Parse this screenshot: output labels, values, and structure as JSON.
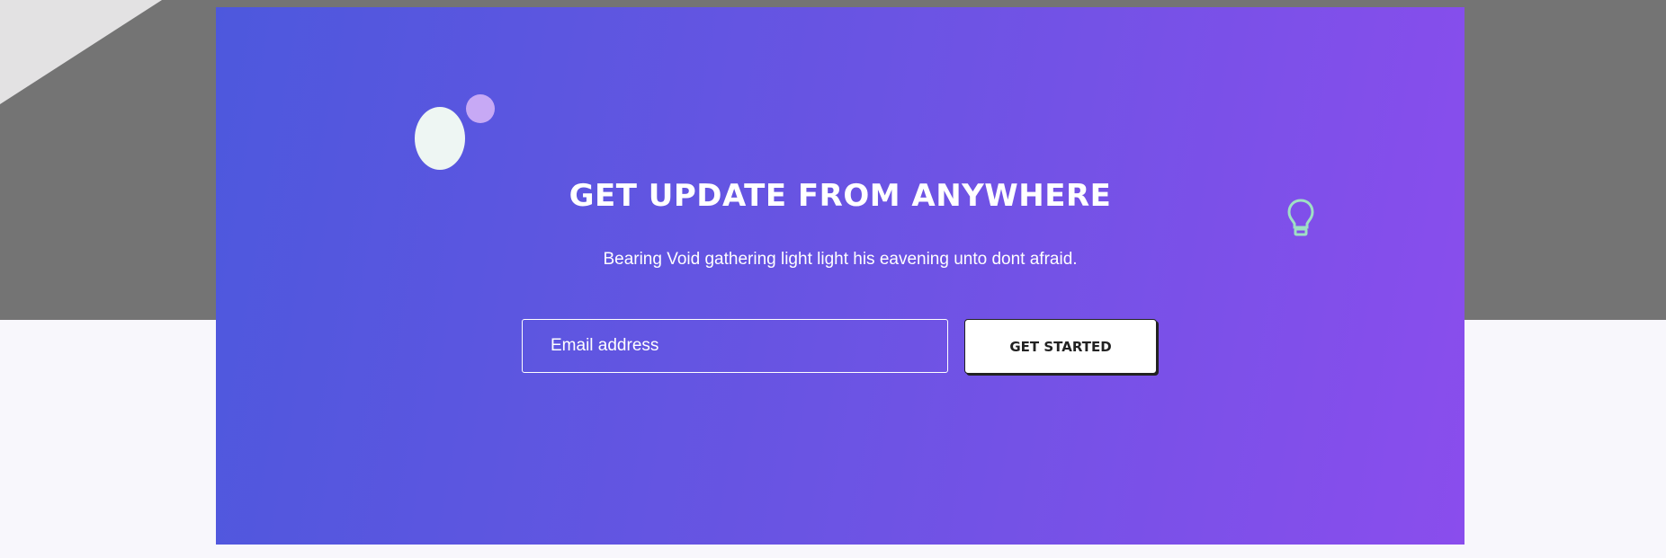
{
  "newsletter": {
    "title": "GET UPDATE FROM ANYWHERE",
    "subtitle": "Bearing Void gathering light light his eavening unto dont afraid.",
    "email_placeholder": "Email address",
    "submit_label": "GET STARTED"
  },
  "icons": {
    "decoration": "lightbulb-icon"
  },
  "colors": {
    "gradient_start": "#4d58dd",
    "gradient_end": "#8a4ded",
    "page_top": "#747474",
    "page_bottom": "#f8f7fc"
  }
}
